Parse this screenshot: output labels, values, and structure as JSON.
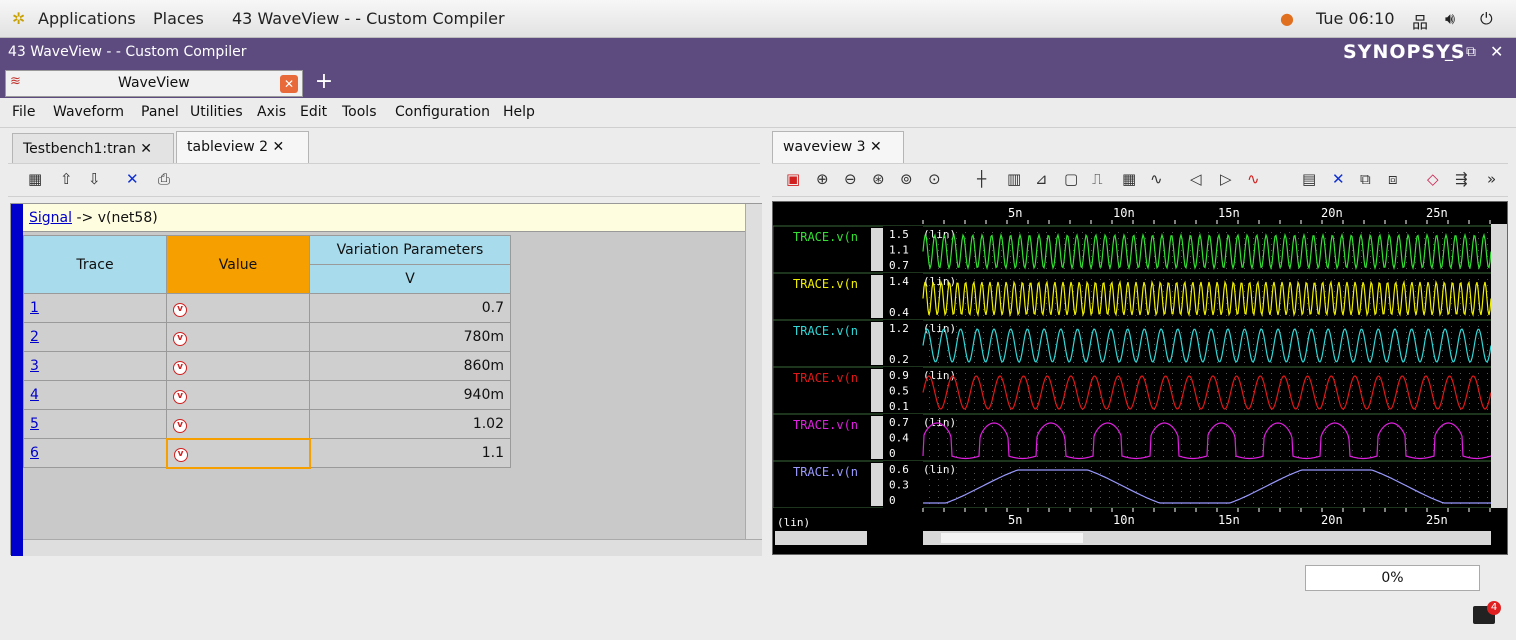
{
  "topbar": {
    "applications": "Applications",
    "places": "Places",
    "window_title": "43 WaveView -  - Custom Compiler",
    "clock": "Tue 06:10"
  },
  "titlebar": {
    "title": "43 WaveView -  - Custom Compiler",
    "brand": "SYNOPSYS"
  },
  "window_tab": {
    "label": "WaveView",
    "add": "+"
  },
  "menu": [
    "File",
    "Waveform",
    "Panel",
    "Utilities",
    "Axis",
    "Edit",
    "Tools",
    "Configuration",
    "Help"
  ],
  "left_tabs": [
    {
      "label": "Testbench1:tran ✕"
    },
    {
      "label": "tableview 2 ✕"
    }
  ],
  "right_tabs": [
    {
      "label": "waveview 3 ✕"
    }
  ],
  "table": {
    "signal_link": "Signal",
    "signal_rest": " -> v(net58)",
    "headers": {
      "trace": "Trace",
      "value": "Value",
      "variation": "Variation Parameters",
      "v": "V"
    },
    "rows": [
      {
        "trace": "1",
        "v": "0.7"
      },
      {
        "trace": "2",
        "v": "780m"
      },
      {
        "trace": "3",
        "v": "860m"
      },
      {
        "trace": "4",
        "v": "940m"
      },
      {
        "trace": "5",
        "v": "1.02"
      },
      {
        "trace": "6",
        "v": "1.1"
      }
    ]
  },
  "wave": {
    "x_ticks": [
      "5n",
      "10n",
      "15n",
      "20n",
      "25n"
    ],
    "lin_label": "(lin)",
    "traces": [
      {
        "name": "TRACE.v(n",
        "color": "#33e033",
        "labels": [
          "1.5",
          "1.1",
          "0.7"
        ],
        "freq": 60
      },
      {
        "name": "TRACE.v(n",
        "color": "#f0f000",
        "labels": [
          "1.4",
          "0.4"
        ],
        "freq": 70
      },
      {
        "name": "TRACE.v(n",
        "color": "#30d8d8",
        "labels": [
          "1.2",
          "0.2"
        ],
        "freq": 34
      },
      {
        "name": "TRACE.v(n",
        "color": "#e01818",
        "labels": [
          "0.9",
          "0.5",
          "0.1"
        ],
        "freq": 24
      },
      {
        "name": "TRACE.v(n",
        "color": "#e020e0",
        "labels": [
          "0.7",
          "0.4",
          "0"
        ],
        "freq": 10
      },
      {
        "name": "TRACE.v(n",
        "color": "#9a9aff",
        "labels": [
          "0.6",
          "0.3",
          "0"
        ],
        "freq": 2
      }
    ]
  },
  "status": {
    "progress": "0%",
    "badge": "4"
  }
}
